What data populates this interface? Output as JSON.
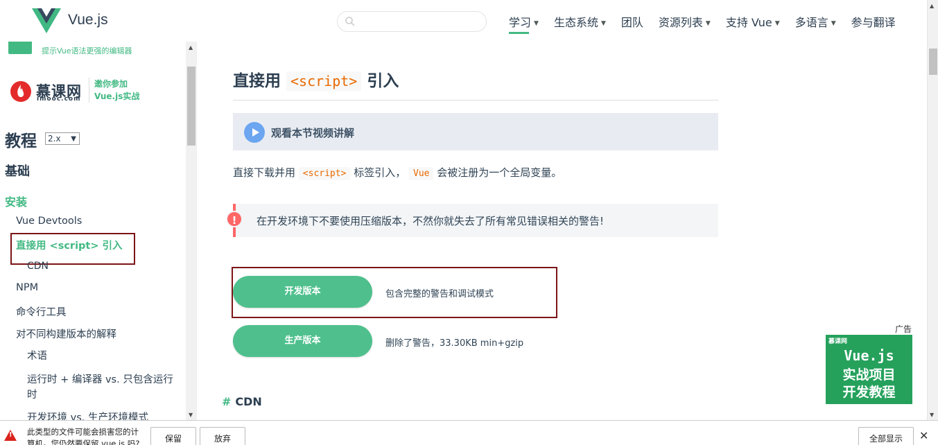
{
  "header": {
    "logo_text": "Vue.js",
    "search_placeholder": "",
    "nav": [
      {
        "label": "学习"
      },
      {
        "label": "生态系统"
      },
      {
        "label": "团队"
      },
      {
        "label": "资源列表"
      },
      {
        "label": "支持 Vue"
      },
      {
        "label": "多语言"
      },
      {
        "label": "参与翻译"
      }
    ],
    "accent": "#42b983"
  },
  "sidebar": {
    "ad_text": "提示Vue语法更强的编辑器",
    "imooc_name": "慕课网",
    "imooc_sub": "imooc.com",
    "imooc_invite_1": "邀你参加",
    "imooc_invite_2": "Vue.js实战",
    "title": "教程",
    "version": "2.x",
    "section_basics": "基础",
    "section_install": "安装",
    "items": [
      {
        "label": "Vue Devtools"
      },
      {
        "label": "直接用 <script> 引入"
      },
      {
        "label": "CDN"
      },
      {
        "label": "NPM"
      },
      {
        "label": "命令行工具"
      },
      {
        "label": "对不同构建版本的解释"
      },
      {
        "label": "术语"
      },
      {
        "label": "运行时 + 编译器 vs. 只包含运行"
      },
      {
        "label": "时"
      },
      {
        "label": "开发环境 vs. 生产环境模式"
      }
    ]
  },
  "content": {
    "h1_pre": "直接用",
    "h1_code": "<script>",
    "h1_post": "引入",
    "video_text": "观看本节视频讲解",
    "para_1": "直接下载并用",
    "para_code_1": "<script>",
    "para_2": "标签引入，",
    "para_code_2": "Vue",
    "para_3": "会被注册为一个全局变量。",
    "tip": "在开发环境下不要使用压缩版本，不然你就失去了所有常见错误相关的警告!",
    "dev_button": "开发版本",
    "dev_desc": "包含完整的警告和调试模式",
    "prod_button": "生产版本",
    "prod_desc": "删除了警告，33.30KB min+gzip",
    "cdn_heading": "CDN",
    "hash": "#"
  },
  "ad": {
    "label": "广告",
    "brand": "慕课网",
    "line1": "Vue.js",
    "line2": "实战项目",
    "line3": "开发教程"
  },
  "download_bar": {
    "msg_line1": "此类型的文件可能会损害您的计",
    "msg_line2": "算机。您仍然要保留 vue.js 吗?",
    "keep": "保留",
    "discard": "放弃",
    "show_all": "全部显示",
    "close": "✕"
  }
}
